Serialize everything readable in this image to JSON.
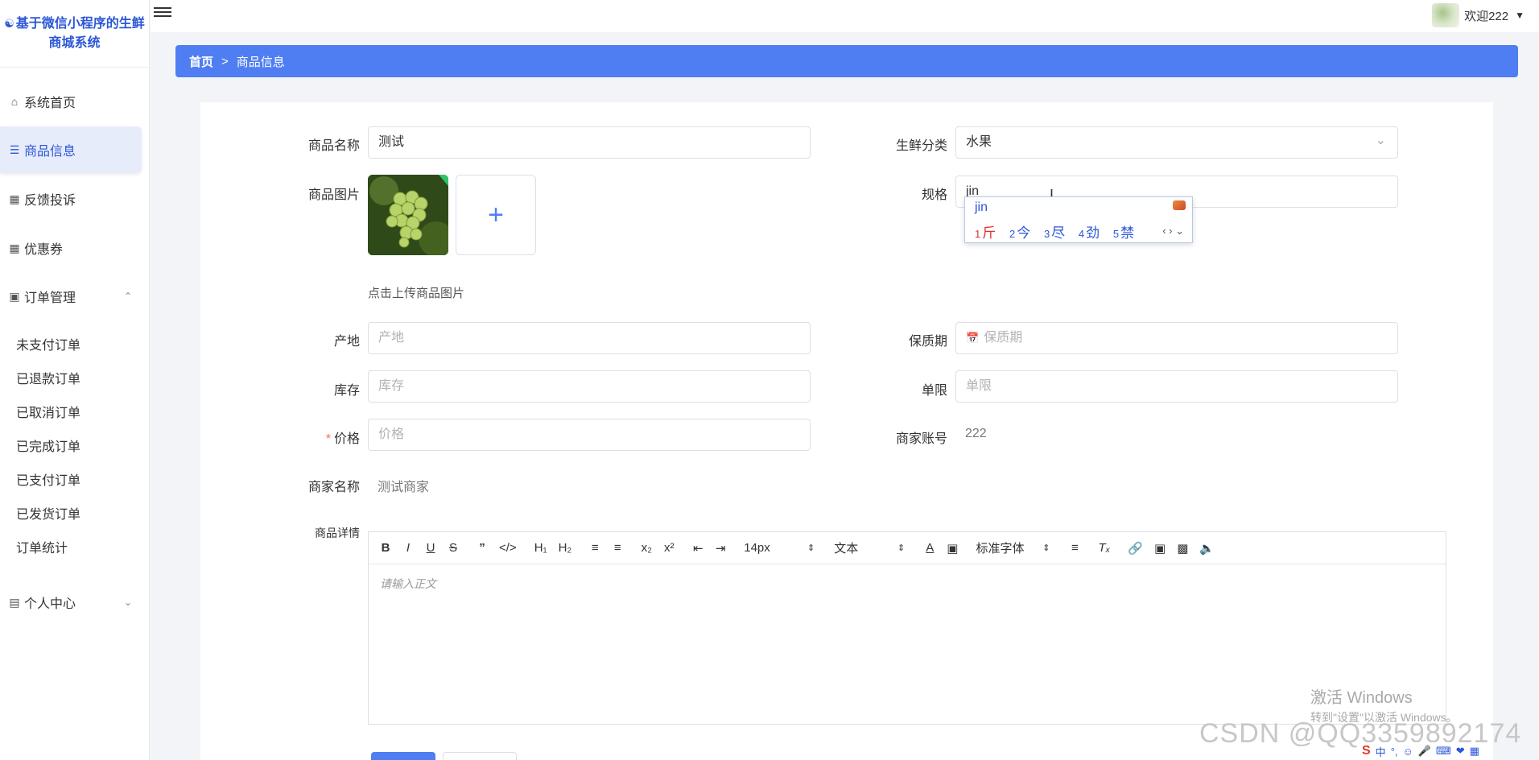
{
  "app": {
    "brand_title": "基于微信小程序的生鲜商城系统"
  },
  "sidebar": {
    "items": [
      {
        "label": "系统首页",
        "icon": "home-icon"
      },
      {
        "label": "商品信息",
        "icon": "list-icon"
      },
      {
        "label": "反馈投诉",
        "icon": "grid-icon"
      },
      {
        "label": "优惠券",
        "icon": "grid-icon"
      },
      {
        "label": "订单管理",
        "icon": "monitor-icon"
      },
      {
        "label": "个人中心",
        "icon": "card-icon"
      }
    ],
    "order_sub": [
      "未支付订单",
      "已退款订单",
      "已取消订单",
      "已完成订单",
      "已支付订单",
      "已发货订单",
      "订单统计"
    ]
  },
  "header": {
    "welcome": "欢迎222"
  },
  "breadcrumb": {
    "home": "首页",
    "sep": ">",
    "current": "商品信息"
  },
  "form": {
    "name_label": "商品名称",
    "name_value": "测试",
    "category_label": "生鲜分类",
    "category_value": "水果",
    "image_label": "商品图片",
    "spec_label": "规格",
    "spec_value": "jin",
    "upload_hint": "点击上传商品图片",
    "origin_label": "产地",
    "origin_placeholder": "产地",
    "shelf_label": "保质期",
    "shelf_placeholder": "保质期",
    "stock_label": "库存",
    "stock_placeholder": "库存",
    "limit_label": "单限",
    "limit_placeholder": "单限",
    "price_label": "价格",
    "price_placeholder": "价格",
    "merchant_account_label": "商家账号",
    "merchant_account_value": "222",
    "merchant_name_label": "商家名称",
    "merchant_name_value": "测试商家",
    "detail_label": "商品详情",
    "editor_placeholder": "请输入正文"
  },
  "ime": {
    "composition": "jin",
    "candidates": [
      {
        "n": "1",
        "c": "斤"
      },
      {
        "n": "2",
        "c": "今"
      },
      {
        "n": "3",
        "c": "尽"
      },
      {
        "n": "4",
        "c": "劲"
      },
      {
        "n": "5",
        "c": "禁"
      }
    ]
  },
  "editor_toolbar": {
    "size": "14px",
    "header": "文本",
    "font": "标准字体"
  },
  "watermarks": {
    "win_line1": "激活 Windows",
    "win_line2": "转到\"设置\"以激活 Windows。",
    "csdn": "CSDN @QQ3359892174"
  },
  "tray": {
    "zh": "中"
  },
  "colors": {
    "primary": "#4f7ef3",
    "brand": "#2b56d6",
    "required": "#f56c6c"
  }
}
